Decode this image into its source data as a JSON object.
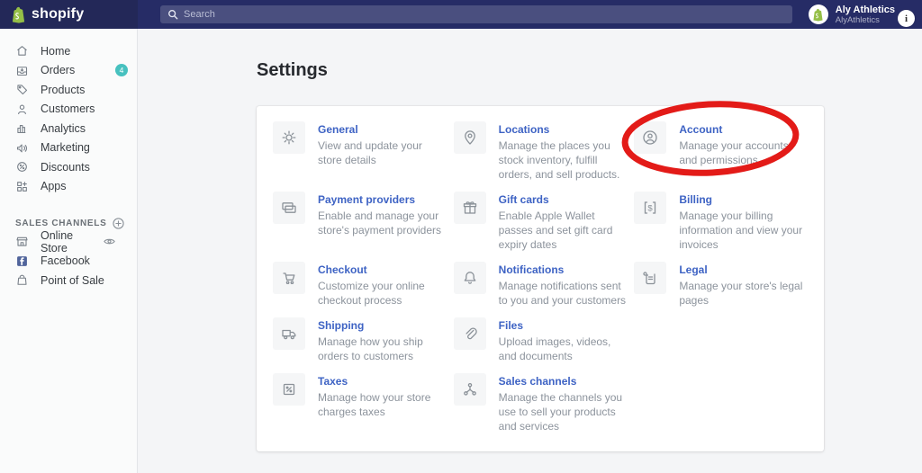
{
  "topbar": {
    "brand": "shopify",
    "search": {
      "placeholder": "Search"
    },
    "user": {
      "name": "Aly Athletics",
      "store": "AlyAthletics",
      "info_glyph": "i"
    }
  },
  "sidebar": {
    "items": [
      {
        "label": "Home"
      },
      {
        "label": "Orders",
        "badge": "4"
      },
      {
        "label": "Products"
      },
      {
        "label": "Customers"
      },
      {
        "label": "Analytics"
      },
      {
        "label": "Marketing"
      },
      {
        "label": "Discounts"
      },
      {
        "label": "Apps"
      }
    ],
    "sales_channels": {
      "heading": "SALES CHANNELS",
      "items": [
        {
          "label": "Online Store"
        },
        {
          "label": "Facebook"
        },
        {
          "label": "Point of Sale"
        }
      ]
    }
  },
  "main": {
    "title": "Settings",
    "cards": [
      {
        "title": "General",
        "description": "View and update your store details"
      },
      {
        "title": "Locations",
        "description": "Manage the places you stock inventory, fulfill orders, and sell products."
      },
      {
        "title": "Account",
        "description": "Manage your accounts and permissions"
      },
      {
        "title": "Payment providers",
        "description": "Enable and manage your store's payment providers"
      },
      {
        "title": "Gift cards",
        "description": "Enable Apple Wallet passes and set gift card expiry dates"
      },
      {
        "title": "Billing",
        "description": "Manage your billing information and view your invoices"
      },
      {
        "title": "Checkout",
        "description": "Customize your online checkout process"
      },
      {
        "title": "Notifications",
        "description": "Manage notifications sent to you and your customers"
      },
      {
        "title": "Legal",
        "description": "Manage your store's legal pages"
      },
      {
        "title": "Shipping",
        "description": "Manage how you ship orders to customers"
      },
      {
        "title": "Files",
        "description": "Upload images, videos, and documents"
      },
      {
        "title": "Taxes",
        "description": "Manage how your store charges taxes"
      },
      {
        "title": "Sales channels",
        "description": "Manage the channels you use to sell your products and services"
      }
    ]
  },
  "colors": {
    "topbar_bg": "#262c66",
    "link_blue": "#3e63c4",
    "badge_teal": "#47c1bf",
    "annotation_red": "#e31b18"
  }
}
